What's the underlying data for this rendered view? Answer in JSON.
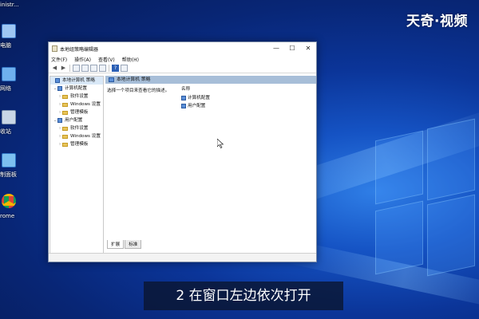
{
  "watermark": "天奇·视频",
  "caption": "2 在窗口左边依次打开",
  "desktop_icons": [
    {
      "label": "inistr..."
    },
    {
      "label": "电脑"
    },
    {
      "label": "网络"
    },
    {
      "label": "收站"
    },
    {
      "label": "制面板"
    },
    {
      "label": "rome"
    }
  ],
  "window": {
    "title": "本地组策略编辑器",
    "controls": {
      "minimize": "—",
      "maximize": "☐",
      "close": "✕"
    },
    "menu": [
      "文件(F)",
      "操作(A)",
      "查看(V)",
      "帮助(H)"
    ],
    "toolbar": {
      "back": "◀",
      "forward": "▶",
      "help": "?"
    },
    "tree": {
      "root": "本地计算机 策略",
      "computer_config": "计算机配置",
      "computer_children": [
        "软件设置",
        "Windows 设置",
        "管理模板"
      ],
      "user_config": "用户配置",
      "user_children": [
        "软件设置",
        "Windows 设置",
        "管理模板"
      ]
    },
    "right": {
      "header": "本地计算机 策略",
      "description": "选择一个项目来查看它的描述。",
      "column_name": "名称",
      "items": [
        "计算机配置",
        "用户配置"
      ],
      "tabs": [
        "扩展",
        "标准"
      ]
    }
  },
  "colors": {
    "wallpaper": "#1553c4",
    "header_strip": "#a7bed8",
    "caption_bg": "#0a142d"
  }
}
